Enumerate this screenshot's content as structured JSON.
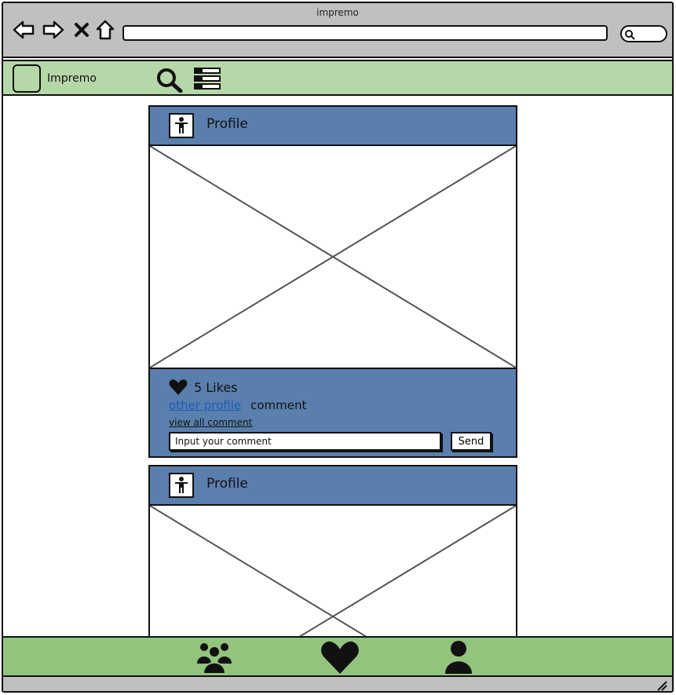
{
  "browser": {
    "title": "impremo",
    "icons": [
      "back-icon",
      "forward-icon",
      "close-icon",
      "home-icon",
      "search-icon"
    ]
  },
  "app": {
    "name": "Impremo",
    "header_icons": [
      "search-icon",
      "menu-icon"
    ],
    "colors": {
      "header": "#b6d7a8",
      "tabbar": "#93c47d",
      "post": "#5a7fad"
    }
  },
  "posts": [
    {
      "profile_label": "Profile",
      "likes": "5 Likes",
      "comment_author": "other profile",
      "comment_text": "comment",
      "view_all": "view all comment",
      "input_placeholder": "Input your comment",
      "send_label": "Send"
    },
    {
      "profile_label": "Profile"
    }
  ],
  "tabbar": {
    "items": [
      "group-icon",
      "heart-icon",
      "user-icon"
    ]
  }
}
